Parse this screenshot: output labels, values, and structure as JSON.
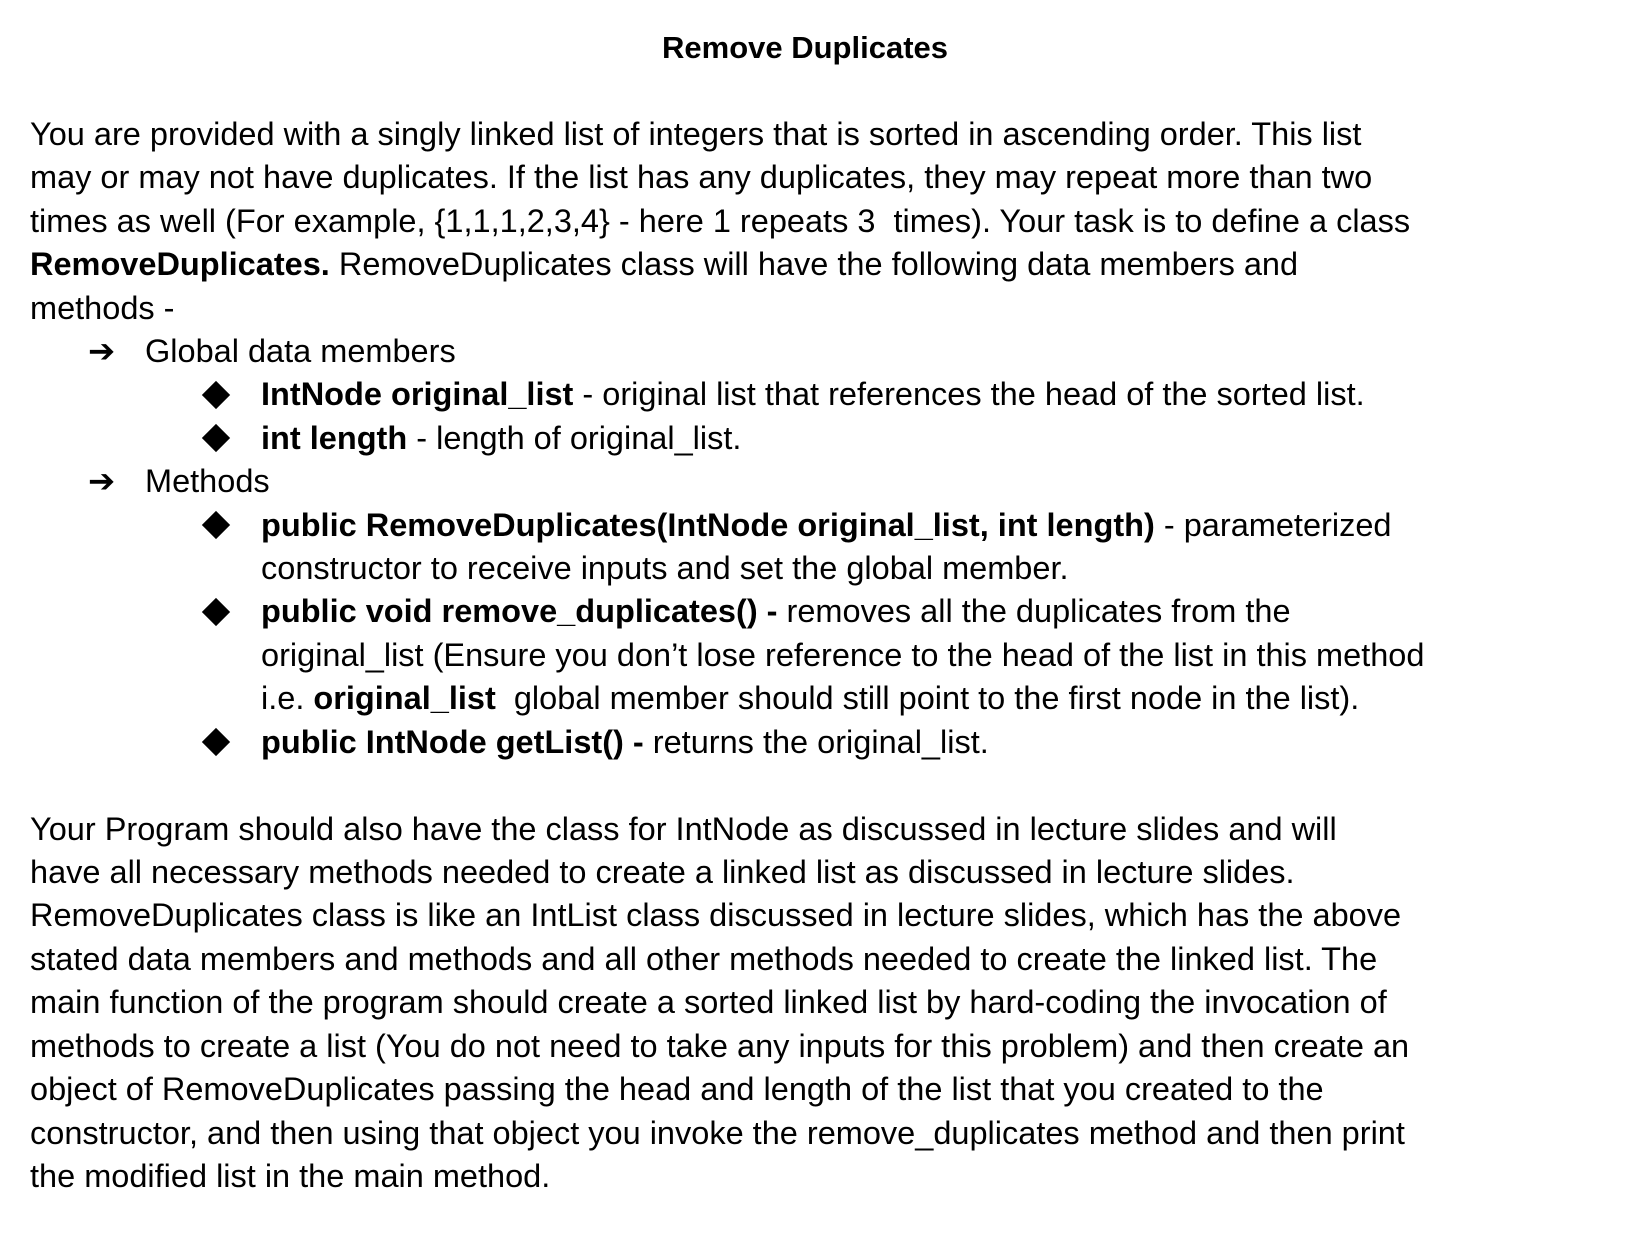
{
  "title": "Remove Duplicates",
  "lines": [
    {
      "bullet": "none",
      "segs": [
        {
          "t": "You are provided with a singly linked list of integers that is sorted in ascending order. This list",
          "b": false
        }
      ]
    },
    {
      "bullet": "none",
      "segs": [
        {
          "t": "may or may not have duplicates. If the list has any duplicates, they may repeat more than two",
          "b": false
        }
      ]
    },
    {
      "bullet": "none",
      "segs": [
        {
          "t": "times as well (For example, {1,1,1,2,3,4} - here 1 repeats 3  times). Your task is to define a class",
          "b": false
        }
      ]
    },
    {
      "bullet": "none",
      "segs": [
        {
          "t": "RemoveDuplicates.",
          "b": true
        },
        {
          "t": " RemoveDuplicates class will have the following data members and",
          "b": false
        }
      ]
    },
    {
      "bullet": "none",
      "segs": [
        {
          "t": "methods -",
          "b": false
        }
      ]
    },
    {
      "bullet": "arrow",
      "segs": [
        {
          "t": "Global data members",
          "b": false
        }
      ]
    },
    {
      "bullet": "diamond",
      "segs": [
        {
          "t": "IntNode original_list",
          "b": true
        },
        {
          "t": " - original list that references the head of the sorted list.",
          "b": false
        }
      ]
    },
    {
      "bullet": "diamond",
      "segs": [
        {
          "t": "int length",
          "b": true
        },
        {
          "t": " - length of original_list.",
          "b": false
        }
      ]
    },
    {
      "bullet": "arrow",
      "segs": [
        {
          "t": "Methods",
          "b": false
        }
      ]
    },
    {
      "bullet": "diamond",
      "segs": [
        {
          "t": "public RemoveDuplicates(IntNode original_list, int length)",
          "b": true
        },
        {
          "t": " - parameterized",
          "b": false
        }
      ]
    },
    {
      "bullet": "cont",
      "segs": [
        {
          "t": "constructor to receive inputs and set the global member.",
          "b": false
        }
      ]
    },
    {
      "bullet": "diamond",
      "segs": [
        {
          "t": "public void remove_duplicates() -",
          "b": true
        },
        {
          "t": " removes all the duplicates from the",
          "b": false
        }
      ]
    },
    {
      "bullet": "cont",
      "segs": [
        {
          "t": "original_list (Ensure you don’t lose reference to the head of the list in this method",
          "b": false
        }
      ]
    },
    {
      "bullet": "cont",
      "segs": [
        {
          "t": "i.e. ",
          "b": false
        },
        {
          "t": "original_list",
          "b": true
        },
        {
          "t": "  global member should still point to the first node in the list).",
          "b": false
        }
      ]
    },
    {
      "bullet": "diamond",
      "segs": [
        {
          "t": "public IntNode getList() -",
          "b": true
        },
        {
          "t": " returns the original_list.",
          "b": false
        }
      ]
    },
    {
      "bullet": "blank",
      "segs": []
    },
    {
      "bullet": "none",
      "segs": [
        {
          "t": "Your Program should also have the class for IntNode as discussed in lecture slides and will",
          "b": false
        }
      ]
    },
    {
      "bullet": "none",
      "segs": [
        {
          "t": "have all necessary methods needed to create a linked list as discussed in lecture slides.",
          "b": false
        }
      ]
    },
    {
      "bullet": "none",
      "segs": [
        {
          "t": "RemoveDuplicates class is like an IntList class discussed in lecture slides, which has the above",
          "b": false
        }
      ]
    },
    {
      "bullet": "none",
      "segs": [
        {
          "t": "stated data members and methods and all other methods needed to create the linked list. The",
          "b": false
        }
      ]
    },
    {
      "bullet": "none",
      "segs": [
        {
          "t": "main function of the program should create a sorted linked list by hard-coding the invocation of",
          "b": false
        }
      ]
    },
    {
      "bullet": "none",
      "segs": [
        {
          "t": "methods to create a list (You do not need to take any inputs for this problem) and then create an",
          "b": false
        }
      ]
    },
    {
      "bullet": "none",
      "segs": [
        {
          "t": "object of RemoveDuplicates passing the head and length of the list that you created to the",
          "b": false
        }
      ]
    },
    {
      "bullet": "none",
      "segs": [
        {
          "t": "constructor, and then using that object you invoke the remove_duplicates method and then print",
          "b": false
        }
      ]
    },
    {
      "bullet": "none",
      "segs": [
        {
          "t": "the modified list in the main method.",
          "b": false
        }
      ]
    }
  ]
}
